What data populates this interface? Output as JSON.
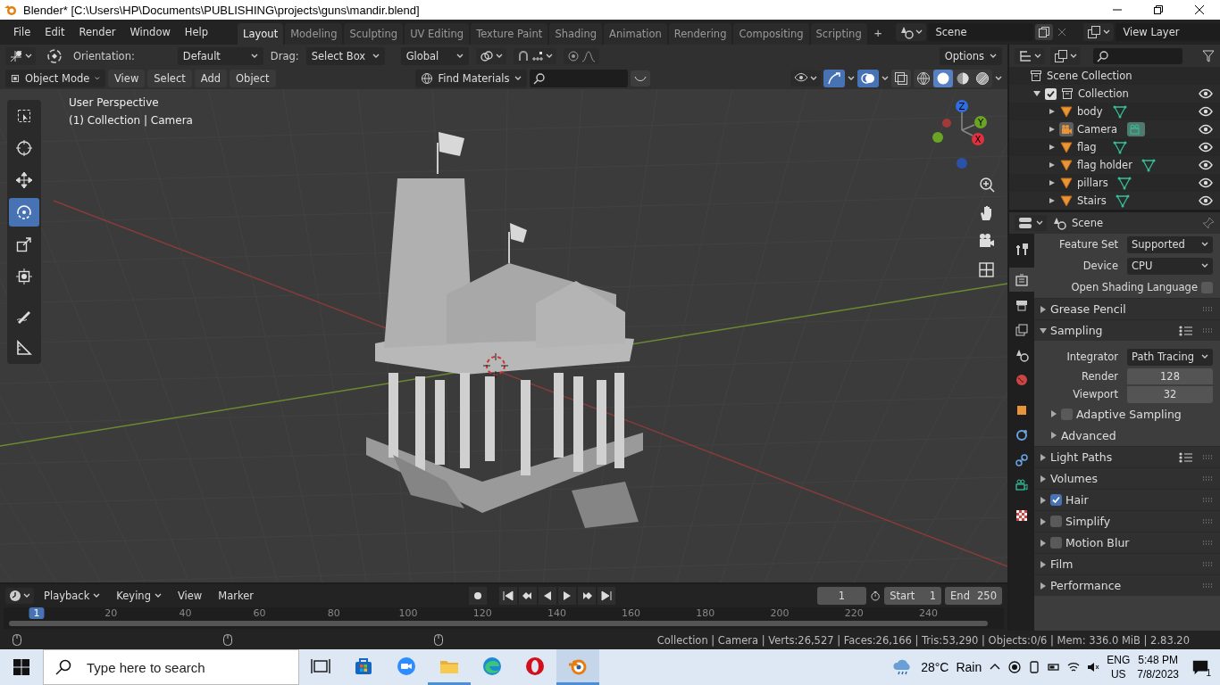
{
  "window": {
    "title": "Blender* [C:\\Users\\HP\\Documents\\PUBLISHING\\projects\\guns\\mandir.blend]"
  },
  "menu": [
    "File",
    "Edit",
    "Render",
    "Window",
    "Help"
  ],
  "workspaces": [
    {
      "label": "Layout",
      "selected": true
    },
    {
      "label": "Modeling",
      "selected": false
    },
    {
      "label": "Sculpting",
      "selected": false
    },
    {
      "label": "UV Editing",
      "selected": false
    },
    {
      "label": "Texture Paint",
      "selected": false
    },
    {
      "label": "Shading",
      "selected": false
    },
    {
      "label": "Animation",
      "selected": false
    },
    {
      "label": "Rendering",
      "selected": false
    },
    {
      "label": "Compositing",
      "selected": false
    },
    {
      "label": "Scripting",
      "selected": false
    }
  ],
  "add_workspace": "+",
  "scene": "Scene",
  "view_layer": "View Layer",
  "tool_header": {
    "orientation_label": "Orientation:",
    "orientation": "Default",
    "drag_label": "Drag:",
    "drag": "Select Box",
    "transform": "Global",
    "options": "Options"
  },
  "viewport_header": {
    "mode": "Object Mode",
    "menus": [
      "View",
      "Select",
      "Add",
      "Object"
    ],
    "find": "Find Materials",
    "shading": [
      {
        "kind": "wireframe",
        "selected": false
      },
      {
        "kind": "solid",
        "selected": true
      },
      {
        "kind": "material",
        "selected": false
      },
      {
        "kind": "rendered",
        "selected": false
      }
    ]
  },
  "viewport": {
    "info": [
      "User Perspective",
      "(1) Collection | Camera"
    ],
    "gizmo_axes": [
      "Z",
      "Y",
      "X"
    ],
    "toolbar": [
      {
        "kind": "select",
        "selected": false
      },
      {
        "kind": "cursor",
        "selected": false
      },
      {
        "kind": "move",
        "selected": false
      },
      {
        "kind": "rotate",
        "selected": true
      },
      {
        "kind": "scale",
        "selected": false
      },
      {
        "kind": "transform",
        "selected": false
      },
      {
        "kind": "annotate",
        "selected": false
      },
      {
        "kind": "measure",
        "selected": false
      }
    ]
  },
  "outliner": {
    "root": "Scene Collection",
    "collection": {
      "name": "Collection",
      "checked": true,
      "expanded": true,
      "children": [
        {
          "name": "body",
          "kind": "mesh"
        },
        {
          "name": "Camera",
          "kind": "camera"
        },
        {
          "name": "flag",
          "kind": "mesh"
        },
        {
          "name": "flag holder",
          "kind": "mesh"
        },
        {
          "name": "pillars",
          "kind": "mesh"
        },
        {
          "name": "Stairs",
          "kind": "mesh"
        }
      ]
    }
  },
  "properties": {
    "context": "Scene",
    "tabs": [
      {
        "kind": "tool",
        "selected": false
      },
      {
        "kind": "render",
        "selected": true
      },
      {
        "kind": "output",
        "selected": false
      },
      {
        "kind": "view-layer",
        "selected": false
      },
      {
        "kind": "scene",
        "selected": false
      },
      {
        "kind": "world",
        "selected": false
      },
      {
        "kind": "object",
        "selected": false
      },
      {
        "kind": "physics",
        "selected": false
      },
      {
        "kind": "constraints",
        "selected": false
      },
      {
        "kind": "camera-data",
        "selected": false
      },
      {
        "kind": "texture",
        "selected": false
      }
    ],
    "rows": [
      {
        "kind": "dropdown",
        "label": "Feature Set",
        "value": "Supported"
      },
      {
        "kind": "dropdown",
        "label": "Device",
        "value": "CPU"
      },
      {
        "kind": "toggle",
        "label": "Open Shading Language",
        "checked": false
      },
      {
        "kind": "panel",
        "label": "Grease Pencil",
        "expanded": false
      },
      {
        "kind": "panel",
        "label": "Sampling",
        "expanded": true,
        "presets": true
      },
      {
        "kind": "dropdown",
        "label": "Integrator",
        "value": "Path Tracing"
      },
      {
        "kind": "number",
        "label": "Render",
        "value": "128"
      },
      {
        "kind": "number",
        "label": "Viewport",
        "value": "32"
      },
      {
        "kind": "subpanel",
        "label": "Adaptive Sampling",
        "expanded": false,
        "checked": false
      },
      {
        "kind": "subpanel",
        "label": "Advanced",
        "expanded": false
      },
      {
        "kind": "panel",
        "label": "Light Paths",
        "expanded": false,
        "presets": true
      },
      {
        "kind": "panel",
        "label": "Volumes",
        "expanded": false
      },
      {
        "kind": "panel",
        "label": "Hair",
        "expanded": false,
        "checked": true
      },
      {
        "kind": "panel",
        "label": "Simplify",
        "expanded": false,
        "checked": false
      },
      {
        "kind": "panel",
        "label": "Motion Blur",
        "expanded": false,
        "checked": false
      },
      {
        "kind": "panel",
        "label": "Film",
        "expanded": false
      },
      {
        "kind": "panel",
        "label": "Performance",
        "expanded": false
      }
    ]
  },
  "timeline": {
    "menus": [
      "Playback",
      "Keying",
      "View",
      "Marker"
    ],
    "current_frame": "1",
    "start_label": "Start",
    "start": "1",
    "end_label": "End",
    "end": "250",
    "ruler": [
      "1",
      "20",
      "40",
      "60",
      "80",
      "100",
      "120",
      "140",
      "160",
      "180",
      "200",
      "220",
      "240"
    ]
  },
  "status_bar": "Collection | Camera | Verts:26,527 | Faces:26,166 | Tris:53,290 | Objects:0/6 | Mem: 336.0 MiB | 2.83.20",
  "taskbar": {
    "search_placeholder": "Type here to search",
    "apps": [
      {
        "kind": "task-view",
        "running": false,
        "selected": false
      },
      {
        "kind": "store",
        "running": false,
        "selected": false
      },
      {
        "kind": "zoom",
        "running": false,
        "selected": false
      },
      {
        "kind": "files",
        "running": true,
        "selected": false
      },
      {
        "kind": "edge",
        "running": false,
        "selected": false
      },
      {
        "kind": "opera",
        "running": false,
        "selected": false
      },
      {
        "kind": "blender",
        "running": true,
        "selected": true
      }
    ],
    "temperature": "28°C",
    "weather": "Rain",
    "language": "ENG",
    "region": "US",
    "time": "5:48 PM",
    "date": "7/8/2023",
    "notifications": "1"
  }
}
